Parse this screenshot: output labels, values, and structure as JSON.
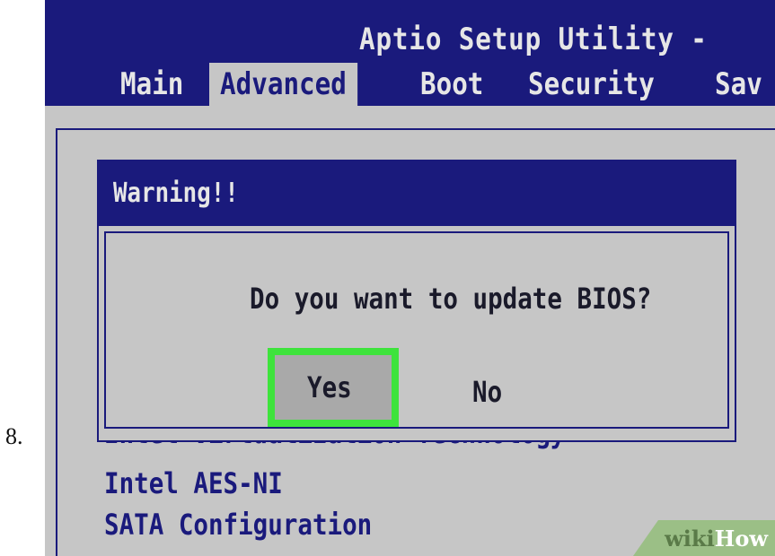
{
  "step_number": "8.",
  "header": {
    "title": "Aptio Setup Utility -",
    "tabs": [
      {
        "label": "Main",
        "active": false
      },
      {
        "label": "Advanced",
        "active": true
      },
      {
        "label": "Boot",
        "active": false
      },
      {
        "label": "Security",
        "active": false
      },
      {
        "label": "Sav",
        "active": false
      }
    ]
  },
  "menu_items": [
    {
      "label": "Intel Virtualization Technology",
      "partially_obscured": true
    },
    {
      "label": "Intel AES-NI"
    },
    {
      "label": "SATA Configuration"
    }
  ],
  "dialog": {
    "title": "Warning!!",
    "message": "Do you want to update BIOS?",
    "yes_label": "Yes",
    "no_label": "No",
    "highlight_color": "#3ee33c"
  },
  "watermark": {
    "part1": "wiki",
    "part2": "How"
  },
  "colors": {
    "bios_blue": "#1a1a7c",
    "bios_gray": "#c6c6c6",
    "header_text": "#e6e6e6"
  }
}
